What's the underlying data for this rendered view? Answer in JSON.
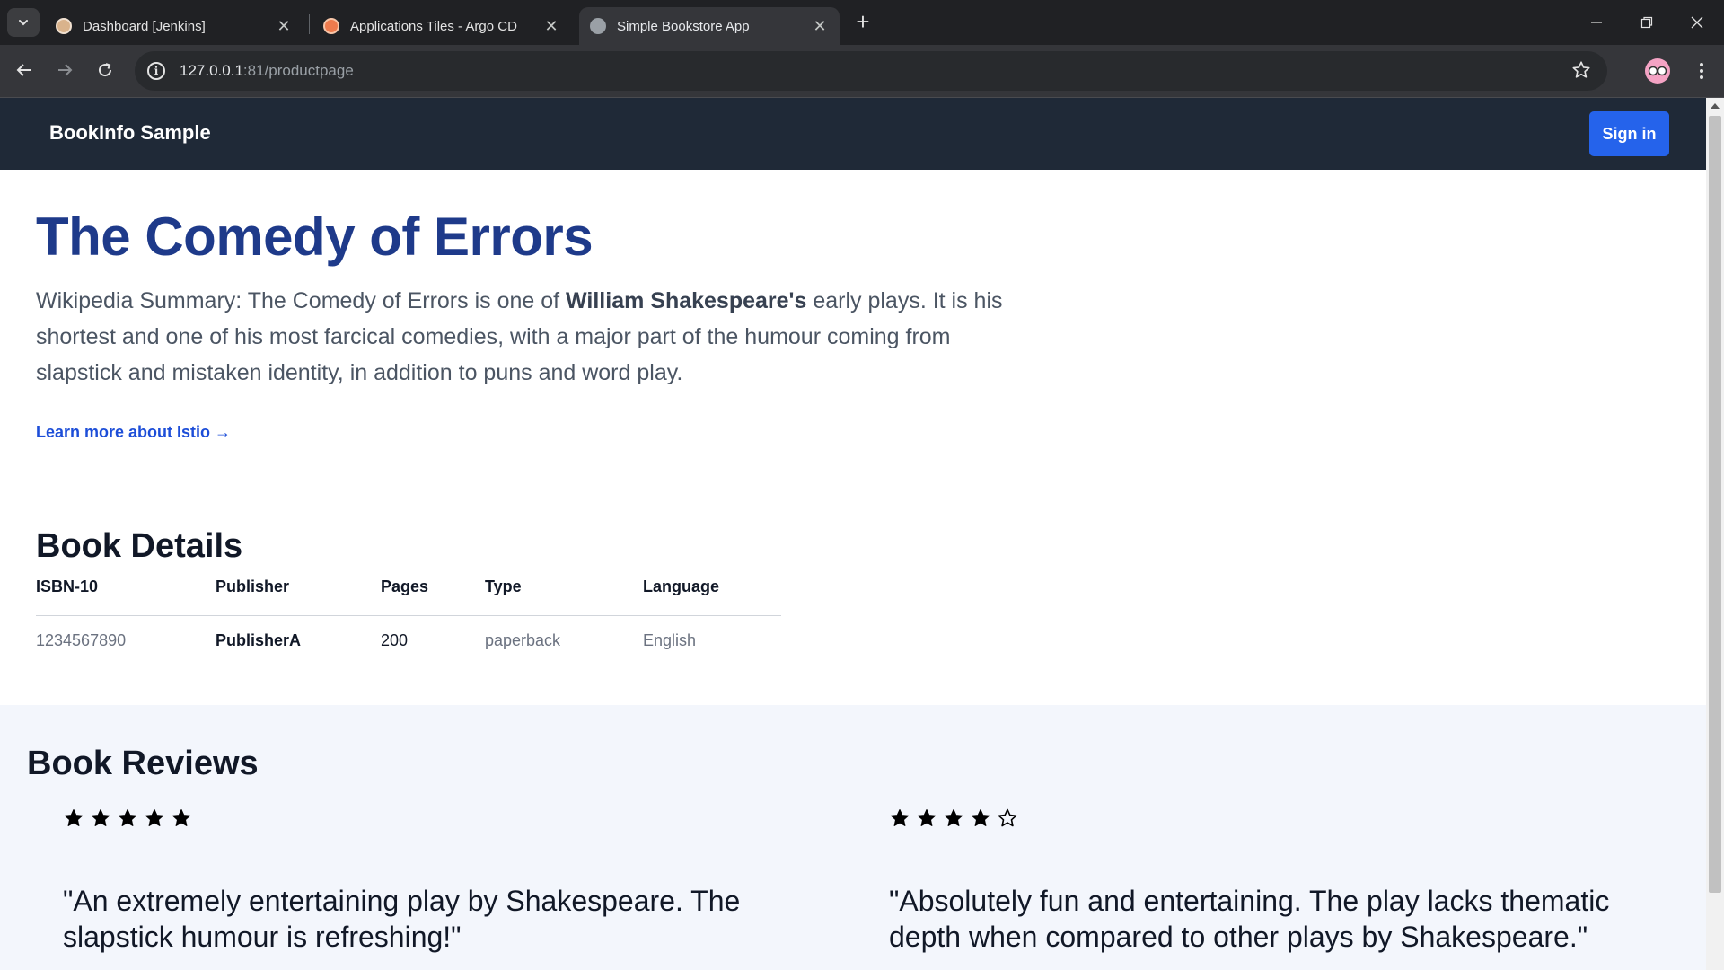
{
  "browser": {
    "tabs": [
      {
        "title": "Dashboard [Jenkins]",
        "icon": "jenkins-icon",
        "active": false
      },
      {
        "title": "Applications Tiles - Argo CD",
        "icon": "argocd-icon",
        "active": false
      },
      {
        "title": "Simple Bookstore App",
        "icon": "globe-icon",
        "active": true
      }
    ],
    "url_host": "127.0.0.1",
    "url_rest": ":81/productpage"
  },
  "navbar": {
    "brand": "BookInfo Sample",
    "signin_label": "Sign in"
  },
  "product": {
    "title": "The Comedy of Errors",
    "summary_before": "Wikipedia Summary: The Comedy of Errors is one of ",
    "summary_bold": "William Shakespeare's",
    "summary_after": " early plays. It is his shortest and one of his most farcical comedies, with a major part of the humour coming from slapstick and mistaken identity, in addition to puns and word play.",
    "learn_more": "Learn more about Istio →"
  },
  "details": {
    "heading": "Book Details",
    "columns": [
      "ISBN-10",
      "Publisher",
      "Pages",
      "Type",
      "Language"
    ],
    "row": [
      "1234567890",
      "PublisherA",
      "200",
      "paperback",
      "English"
    ]
  },
  "reviews": {
    "heading": "Book Reviews",
    "items": [
      {
        "rating": 5,
        "text": "\"An extremely entertaining play by Shakespeare. The slapstick humour is refreshing!\""
      },
      {
        "rating": 4,
        "text": "\"Absolutely fun and entertaining. The play lacks thematic depth when compared to other plays by Shakespeare.\""
      }
    ]
  }
}
